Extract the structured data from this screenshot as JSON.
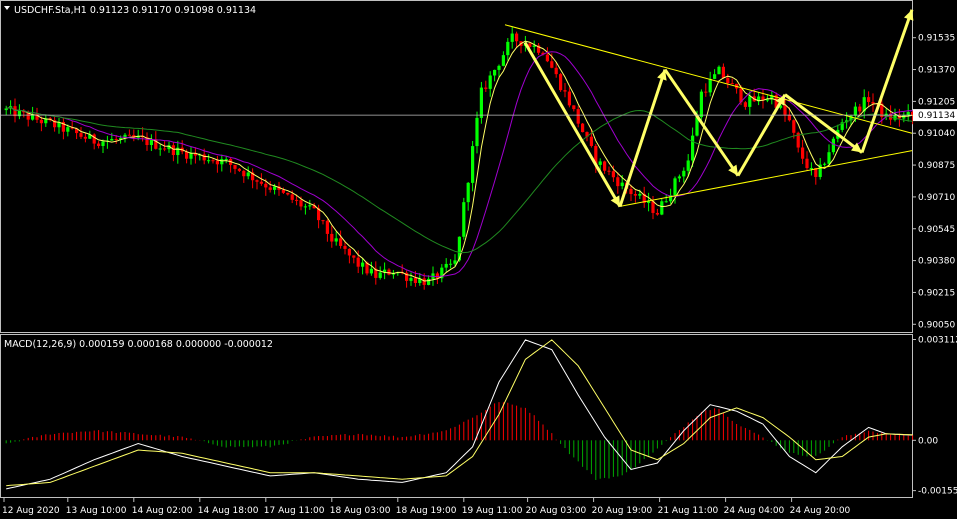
{
  "colors": {
    "background": "#000000",
    "bull": "#00ff00",
    "bear": "#ff0000",
    "trendline": "#ffff00",
    "arrows": "#ffff66",
    "ma_fast": "#ffff66",
    "ma_mid": "#a000d0",
    "ma_slow": "#208a20",
    "bid_line": "#c0c0c0",
    "macd_up": "#ff0000",
    "macd_down": "#00aa00",
    "text": "#ffffff",
    "frame": "#c0c0c0"
  },
  "header": {
    "title": "USDCHF.Sta,H1  0.91123 0.91170 0.91098 0.91134"
  },
  "macd_header": {
    "title": "MACD(12,26,9) 0.000159 0.000168 0.000000 -0.000012"
  },
  "chart_data": [
    {
      "type": "candlestick",
      "title": "USDCHF.Sta,H1",
      "ohlc_last": [
        0.91123,
        0.9117,
        0.91098,
        0.91134
      ],
      "current_price": 0.91134,
      "y_ticks": [
        "0.91535",
        "0.91370",
        "0.91205",
        "0.91040",
        "0.90875",
        "0.90710",
        "0.90545",
        "0.90380",
        "0.90215",
        "0.90050"
      ],
      "y_tick_values": [
        0.91535,
        0.9137,
        0.91205,
        0.9104,
        0.90875,
        0.9071,
        0.90545,
        0.9038,
        0.90215,
        0.9005
      ],
      "ylim": [
        0.9001,
        0.9172
      ],
      "x_ticks": [
        "12 Aug 2020",
        "13 Aug 10:00",
        "14 Aug 02:00",
        "14 Aug 18:00",
        "17 Aug 11:00",
        "18 Aug 03:00",
        "18 Aug 19:00",
        "19 Aug 11:00",
        "20 Aug 03:00",
        "20 Aug 19:00",
        "21 Aug 11:00",
        "24 Aug 04:00",
        "24 Aug 20:00"
      ],
      "price_path": {
        "bars": [
          0,
          10,
          20,
          30,
          40,
          50,
          60,
          70,
          74,
          80,
          84,
          88,
          92,
          96,
          102,
          108,
          115,
          118,
          122,
          128,
          134,
          140,
          148,
          155,
          158,
          162,
          168,
          174,
          178,
          180,
          184,
          190,
          196,
          200,
          206
        ],
        "close": [
          0.9116,
          0.9109,
          0.91,
          0.9101,
          0.9094,
          0.9089,
          0.9076,
          0.9063,
          0.9049,
          0.9036,
          0.903,
          0.9033,
          0.9029,
          0.9027,
          0.9037,
          0.9125,
          0.9153,
          0.9151,
          0.9147,
          0.912,
          0.909,
          0.9077,
          0.9063,
          0.909,
          0.9125,
          0.9136,
          0.912,
          0.9123,
          0.911,
          0.9095,
          0.908,
          0.911,
          0.9122,
          0.9112,
          0.9113
        ]
      },
      "moving_averages": [
        "fast",
        "mid",
        "slow"
      ],
      "annotations": {
        "triangle_upper": [
          [
            0.91602,
            "19 Aug 11:00"
          ],
          [
            0.9104,
            "end"
          ]
        ],
        "triangle_lower": [
          [
            0.9066,
            "20 Aug 19:00"
          ],
          [
            0.9095,
            "end"
          ]
        ],
        "projection_arrows": [
          [
            0.9151,
            0.9066
          ],
          [
            0.9066,
            0.9137
          ],
          [
            0.9137,
            0.9082
          ],
          [
            0.9082,
            0.9124
          ],
          [
            0.9124,
            0.9094
          ],
          [
            0.9094,
            0.9168
          ]
        ]
      }
    },
    {
      "type": "histogram_with_lines",
      "title": "MACD(12,26,9)",
      "values_last": [
        0.000159,
        0.000168,
        0.0,
        -1.2e-05
      ],
      "y_ticks": [
        "0.003112",
        "0.00",
        "-0.001553"
      ],
      "y_tick_values": [
        0.003112,
        0.0,
        -0.001553
      ],
      "ylim": [
        -0.00175,
        0.00322
      ],
      "histogram_path": {
        "bars": [
          0,
          10,
          20,
          30,
          40,
          50,
          60,
          70,
          80,
          90,
          100,
          106,
          112,
          118,
          122,
          128,
          134,
          140,
          146,
          152,
          158,
          162,
          166,
          172,
          178,
          184,
          190,
          196,
          200,
          206
        ],
        "values": [
          -0.0001,
          0.0002,
          0.0003,
          0.0002,
          0.0001,
          -0.0002,
          -0.0002,
          0.0001,
          0.0002,
          0.0001,
          0.0003,
          0.0007,
          0.0012,
          0.001,
          0.0005,
          -0.0004,
          -0.0012,
          -0.0011,
          -0.0005,
          0.0002,
          0.0009,
          0.001,
          0.0005,
          0.0001,
          -0.0004,
          -0.0005,
          0.0001,
          0.0003,
          0.0002,
          0.00015
        ]
      },
      "macd_path": {
        "bars": [
          0,
          10,
          20,
          30,
          40,
          50,
          60,
          70,
          80,
          90,
          100,
          106,
          112,
          118,
          124,
          130,
          136,
          142,
          148,
          154,
          160,
          166,
          172,
          178,
          184,
          190,
          196,
          200,
          206
        ],
        "values": [
          -0.0015,
          -0.0012,
          -0.0006,
          -0.0001,
          -0.0005,
          -0.0008,
          -0.0011,
          -0.001,
          -0.0012,
          -0.0013,
          -0.001,
          -0.0002,
          0.0018,
          0.0031,
          0.0028,
          0.0014,
          0.0001,
          -0.0009,
          -0.0007,
          0.0003,
          0.0011,
          0.0009,
          0.0005,
          -0.0005,
          -0.001,
          -0.0002,
          0.0004,
          0.0002,
          0.00016
        ]
      },
      "signal_path": {
        "bars": [
          0,
          10,
          20,
          30,
          40,
          50,
          60,
          70,
          80,
          90,
          100,
          106,
          112,
          118,
          124,
          130,
          136,
          142,
          148,
          154,
          160,
          166,
          172,
          178,
          184,
          190,
          196,
          200,
          206
        ],
        "values": [
          -0.0014,
          -0.0013,
          -0.0008,
          -0.0003,
          -0.0004,
          -0.0007,
          -0.001,
          -0.001,
          -0.0011,
          -0.0012,
          -0.0011,
          -0.0005,
          0.0008,
          0.0025,
          0.0031,
          0.0023,
          0.001,
          -0.0003,
          -0.0006,
          -0.0001,
          0.0007,
          0.001,
          0.0007,
          0.0001,
          -0.0006,
          -0.0005,
          0.0001,
          0.0002,
          0.00017
        ]
      }
    }
  ]
}
